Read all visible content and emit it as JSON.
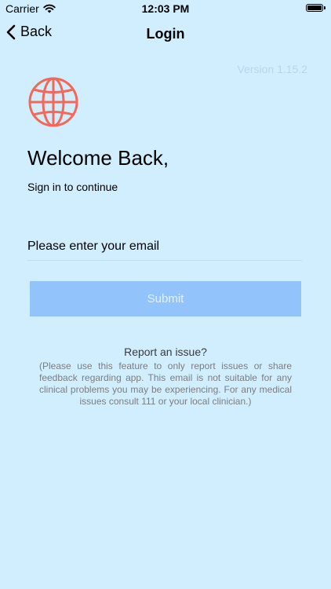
{
  "status_bar": {
    "carrier": "Carrier",
    "time": "12:03 PM"
  },
  "nav": {
    "back_label": "Back",
    "title": "Login"
  },
  "version": "Version 1.15.2",
  "welcome": "Welcome Back,",
  "subtitle": "Sign in to continue",
  "email": {
    "value": "",
    "placeholder": "Please enter your email"
  },
  "submit_label": "Submit",
  "report": {
    "link": "Report an issue?",
    "disclaimer": "(Please use this feature to only report issues or share feedback regarding app. This email is not suitable for any clinical problems you may be experiencing. For any medical issues consult 111 or your local clinician.)"
  },
  "colors": {
    "background": "#d0eefe",
    "accent_globe": "#f2685a",
    "button": "#92c3fb"
  },
  "icons": {
    "wifi": "wifi-icon",
    "battery": "battery-icon",
    "back": "chevron-left-icon",
    "logo": "globe-icon"
  }
}
